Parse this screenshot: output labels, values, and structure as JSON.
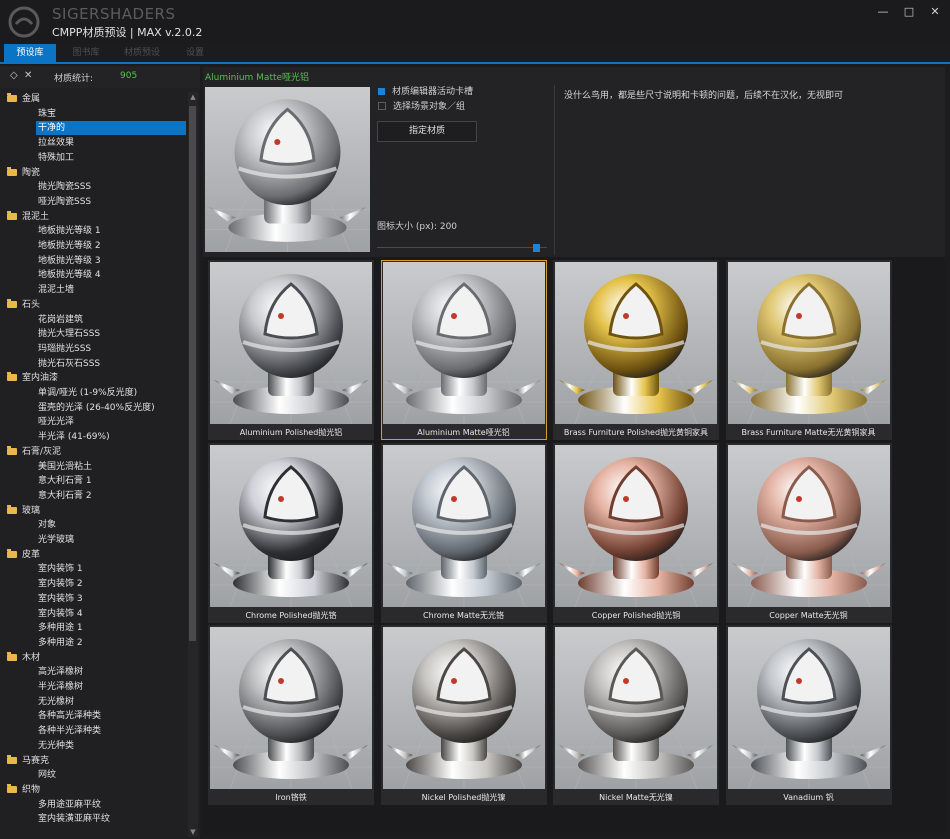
{
  "window": {
    "brand": "SIGERSHADERS",
    "title": "CMPP材质预设 | MAX v.2.0.2",
    "controls": [
      "—",
      "□",
      "✕"
    ]
  },
  "tabs": [
    {
      "label": "预设库",
      "active": true
    },
    {
      "label": "图书库",
      "active": false
    },
    {
      "label": "材质预设",
      "active": false
    },
    {
      "label": "设置",
      "active": false
    }
  ],
  "left_panel": {
    "stats_label": "材质统计:",
    "stats_count": "905",
    "tree": [
      {
        "label": "金属",
        "type": "cat"
      },
      {
        "label": "珠宝",
        "type": "child"
      },
      {
        "label": "干净的",
        "type": "child",
        "selected": true
      },
      {
        "label": "拉丝效果",
        "type": "child"
      },
      {
        "label": "特殊加工",
        "type": "child"
      },
      {
        "label": "陶瓷",
        "type": "cat"
      },
      {
        "label": "抛光陶瓷SSS",
        "type": "child"
      },
      {
        "label": "哑光陶瓷SSS",
        "type": "child"
      },
      {
        "label": "混泥土",
        "type": "cat"
      },
      {
        "label": "地板抛光等级 1",
        "type": "child"
      },
      {
        "label": "地板抛光等级 2",
        "type": "child"
      },
      {
        "label": "地板抛光等级 3",
        "type": "child"
      },
      {
        "label": "地板抛光等级 4",
        "type": "child"
      },
      {
        "label": "混泥土墙",
        "type": "child"
      },
      {
        "label": "石头",
        "type": "cat"
      },
      {
        "label": "花岗岩建筑",
        "type": "child"
      },
      {
        "label": "抛光大理石SSS",
        "type": "child"
      },
      {
        "label": "玛瑙抛光SSS",
        "type": "child"
      },
      {
        "label": "抛光石灰石SSS",
        "type": "child"
      },
      {
        "label": "室内油漆",
        "type": "cat"
      },
      {
        "label": "单调/哑光 (1-9%反光度)",
        "type": "child"
      },
      {
        "label": "蛋壳的光泽 (26-40%反光度)",
        "type": "child"
      },
      {
        "label": "哑光光泽",
        "type": "child"
      },
      {
        "label": "半光泽 (41-69%)",
        "type": "child"
      },
      {
        "label": "石膏/灰泥",
        "type": "cat"
      },
      {
        "label": "美国光滑粘土",
        "type": "child"
      },
      {
        "label": "意大利石膏 1",
        "type": "child"
      },
      {
        "label": "意大利石膏 2",
        "type": "child"
      },
      {
        "label": "玻璃",
        "type": "cat"
      },
      {
        "label": "对象",
        "type": "child"
      },
      {
        "label": "光学玻璃",
        "type": "child"
      },
      {
        "label": "皮革",
        "type": "cat"
      },
      {
        "label": "室内装饰 1",
        "type": "child"
      },
      {
        "label": "室内装饰 2",
        "type": "child"
      },
      {
        "label": "室内装饰 3",
        "type": "child"
      },
      {
        "label": "室内装饰 4",
        "type": "child"
      },
      {
        "label": "多种用途 1",
        "type": "child"
      },
      {
        "label": "多种用途 2",
        "type": "child"
      },
      {
        "label": "木材",
        "type": "cat"
      },
      {
        "label": "高光泽橡树",
        "type": "child"
      },
      {
        "label": "半光泽橡树",
        "type": "child"
      },
      {
        "label": "无光橡树",
        "type": "child"
      },
      {
        "label": "各种高光泽种类",
        "type": "child"
      },
      {
        "label": "各种半光泽种类",
        "type": "child"
      },
      {
        "label": "无光种类",
        "type": "child"
      },
      {
        "label": "马赛克",
        "type": "cat"
      },
      {
        "label": "网纹",
        "type": "child"
      },
      {
        "label": "织物",
        "type": "cat"
      },
      {
        "label": "多用途亚麻平纹",
        "type": "child"
      },
      {
        "label": "室内装潢亚麻平纹",
        "type": "child"
      }
    ]
  },
  "detail": {
    "material_name": "Aluminium Matte哑光铝",
    "checkbox1_label": "材质编辑器活动卡槽",
    "checkbox1_checked": true,
    "checkbox2_label": "选择场景对象／组",
    "checkbox2_checked": false,
    "assign_button": "指定材质",
    "icon_size_label": "图标大小 (px):",
    "icon_size_value": "200",
    "icon_size_fraction": 0.96,
    "description": "没什么鸟用，都是些尺寸说明和卡顿的问题，后续不在汉化，无视即可"
  },
  "materials": [
    {
      "label": "Aluminium Polished抛光铝",
      "tint": "#c9cbcf",
      "dark": "#4a4d52"
    },
    {
      "label": "Aluminium Matte哑光铝",
      "tint": "#c6c8cc",
      "dark": "#6a6c70",
      "selected": true
    },
    {
      "label": "Brass Furniture Polished抛光黄铜家具",
      "tint": "#e5c24a",
      "dark": "#6e5210"
    },
    {
      "label": "Brass Furniture Matte无光黄铜家具",
      "tint": "#e0c873",
      "dark": "#8a7130"
    },
    {
      "label": "Chrome Polished抛光铬",
      "tint": "#cfd2d8",
      "dark": "#2d2f33"
    },
    {
      "label": "Chrome Matte无光铬",
      "tint": "#c3cad2",
      "dark": "#5f656c"
    },
    {
      "label": "Copper Polished抛光铜",
      "tint": "#e6b3a2",
      "dark": "#6f3e30"
    },
    {
      "label": "Copper Matte无光铜",
      "tint": "#e3b4a5",
      "dark": "#8a5c4e"
    },
    {
      "label": "Iron铬铁",
      "tint": "#bdbec0",
      "dark": "#4e4f52"
    },
    {
      "label": "Nickel Polished抛光镍",
      "tint": "#c8c6c2",
      "dark": "#4a4744"
    },
    {
      "label": "Nickel Matte无光镍",
      "tint": "#c1c0be",
      "dark": "#5a5856"
    },
    {
      "label": "Vanadium 钒",
      "tint": "#c3c7cb",
      "dark": "#4d5156"
    }
  ]
}
